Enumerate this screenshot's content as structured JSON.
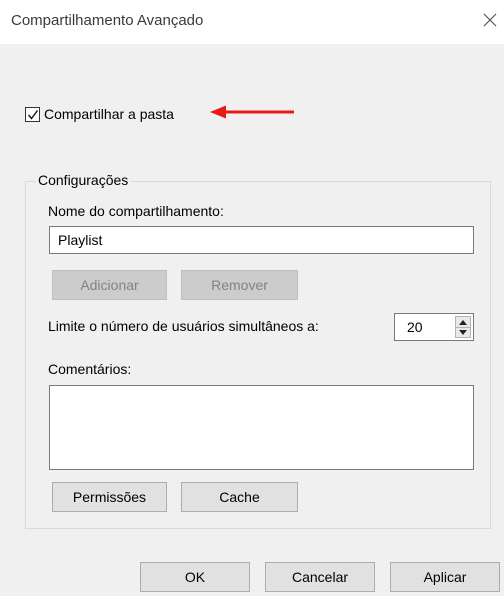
{
  "window": {
    "title": "Compartilhamento Avançado",
    "close_icon": "close-icon"
  },
  "share": {
    "checkbox_label": "Compartilhar a pasta",
    "checked": true,
    "annotation_arrow_color": "#e8191b"
  },
  "settings": {
    "group_title": "Configurações",
    "share_name_label": "Nome do compartilhamento:",
    "share_name_value": "Playlist",
    "add_label": "Adicionar",
    "remove_label": "Remover",
    "limit_label": "Limite o número de usuários simultâneos a:",
    "limit_value": "20",
    "comments_label": "Comentários:",
    "comments_value": "",
    "permissions_label": "Permissões",
    "cache_label": "Cache"
  },
  "footer": {
    "ok_label": "OK",
    "cancel_label": "Cancelar",
    "apply_label": "Aplicar"
  }
}
